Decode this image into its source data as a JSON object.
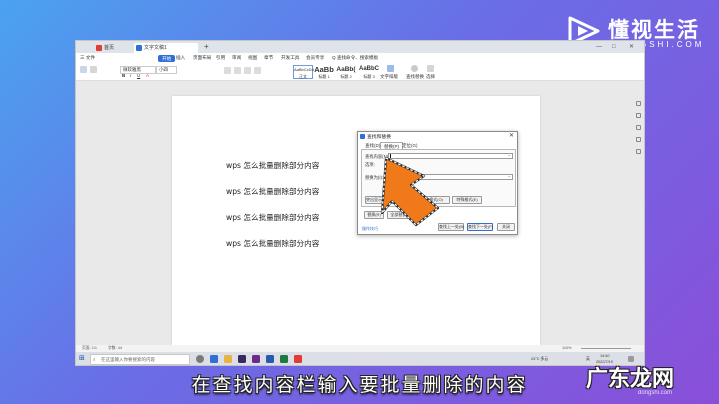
{
  "brand": {
    "name": "懂视生活",
    "domain": "IDONGSHI.COM"
  },
  "browser_tabs": [
    {
      "label": "首页"
    },
    {
      "label": "文字文稿1"
    }
  ],
  "new_tab_symbol": "+",
  "window_controls": {
    "minimize": "—",
    "maximize": "□",
    "close": "✕"
  },
  "menu": {
    "file": "三 文件",
    "items": [
      "开始",
      "插入",
      "页面布局",
      "引用",
      "审阅",
      "视图",
      "章节",
      "开发工具",
      "会员专享",
      "Q 查找命令、搜索模板"
    ]
  },
  "toolbar": {
    "font_name": "微软雅黑",
    "font_size": "小四",
    "styles": [
      {
        "preview": "AaBbCcDd",
        "label": "正文"
      },
      {
        "preview": "AaBb",
        "label": "标题 1"
      },
      {
        "preview": "AaBb(",
        "label": "标题 2"
      },
      {
        "preview": "AaBbC",
        "label": "标题 3"
      }
    ],
    "text_layout": "文字排版",
    "find_replace": "查找替换",
    "select": "选择"
  },
  "document": {
    "paragraphs": [
      "wps 怎么批量删除部分内容",
      "wps 怎么批量删除部分内容",
      "wps 怎么批量删除部分内容",
      "wps 怎么批量删除部分内容"
    ]
  },
  "dialog": {
    "title": "查找和替换",
    "close": "✕",
    "tabs": [
      "查找(D)",
      "替换(P)",
      "定位(G)"
    ],
    "find_label": "查找内容(N):",
    "find_value": "",
    "options_label": "选项:",
    "replace_label": "替换为(I):",
    "replace_value": "",
    "highlight_btn": "突出显示查找内容(R)",
    "read_btn": "阅读(L)",
    "format_btn": "格式(O)",
    "special_btn": "特殊格式(E)",
    "replace_btn": "替换(R)",
    "replace_all_btn": "全部替换(A)",
    "tips_link": "操作技巧",
    "find_prev_btn": "查找上一处(B)",
    "find_next_btn": "查找下一处(F)",
    "close_btn": "关闭"
  },
  "statusbar": {
    "page": "页面: 1/1",
    "words": "字数: 44",
    "zoom": "110%"
  },
  "taskbar": {
    "search_placeholder": "在这里输入你要搜索的内容",
    "weather": "24°C 多云",
    "time": "14:40",
    "date": "2022/7/19",
    "ime": "英"
  },
  "subtitle": "在查找内容栏输入要批量删除的内容",
  "watermark": {
    "text": "广东龙网",
    "url": "dongshi.com"
  },
  "colors": {
    "accent": "#2f6fd6",
    "arrow": "#f07a1a",
    "wps_red": "#e53935"
  }
}
